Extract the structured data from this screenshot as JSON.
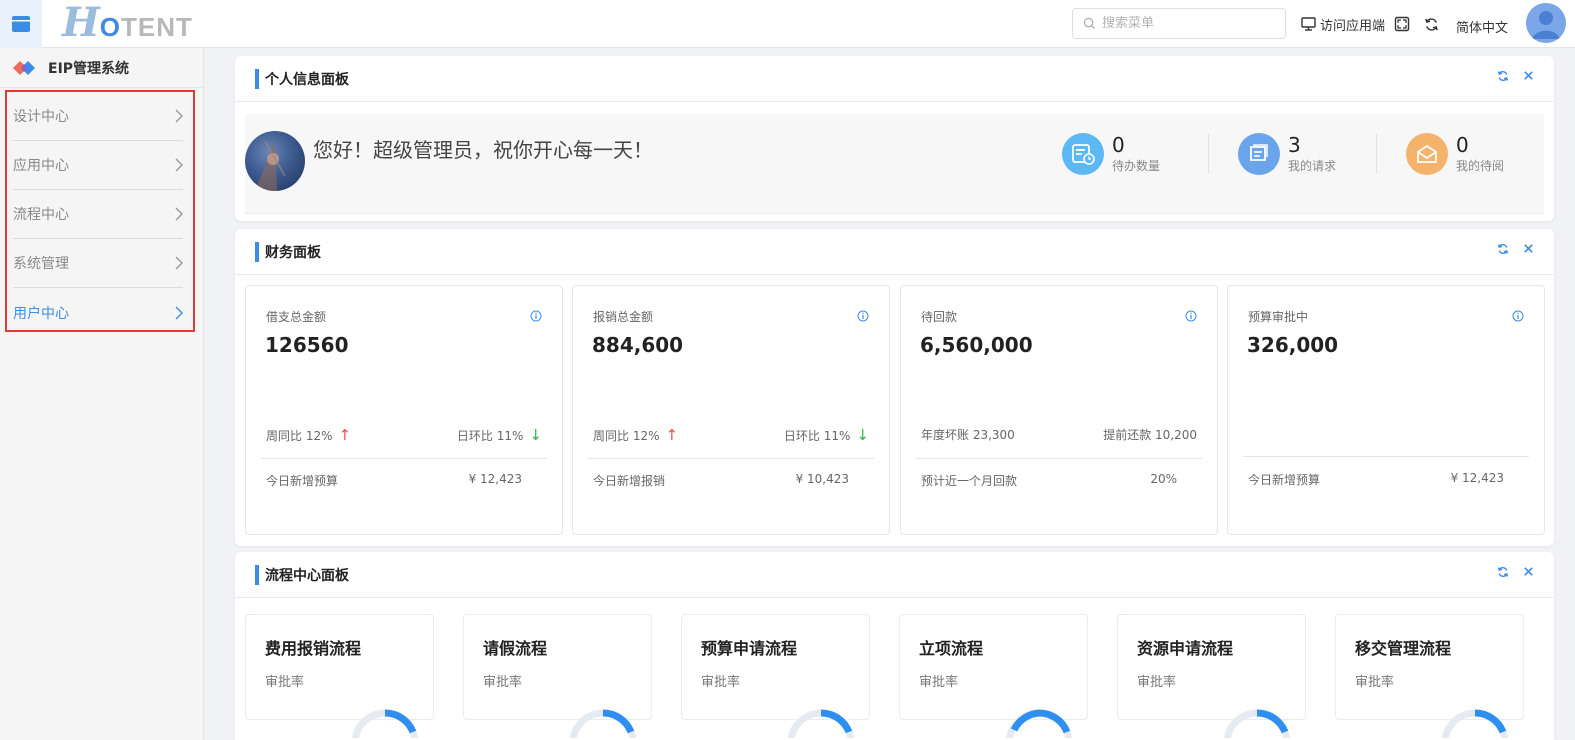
{
  "header": {
    "logo_h": "H",
    "logo_o": "O",
    "logo_rest": "TENT",
    "search_placeholder": "搜索菜单",
    "visit_app": "访问应用端",
    "language": "简体中文"
  },
  "sidebar": {
    "title": "EIP管理系统",
    "items": [
      {
        "label": "设计中心",
        "active": false
      },
      {
        "label": "应用中心",
        "active": false
      },
      {
        "label": "流程中心",
        "active": false
      },
      {
        "label": "系统管理",
        "active": false
      },
      {
        "label": "用户中心",
        "active": true
      }
    ]
  },
  "personal_panel": {
    "title": "个人信息面板",
    "greeting": "您好！超级管理员，祝你开心每一天！",
    "stats": [
      {
        "value": "0",
        "label": "待办数量",
        "icon": "todo-list-icon",
        "color": "#5cb8f2"
      },
      {
        "value": "3",
        "label": "我的请求",
        "icon": "request-icon",
        "color": "#6aa5ec"
      },
      {
        "value": "0",
        "label": "我的待阅",
        "icon": "mail-icon",
        "color": "#f5b26b"
      }
    ]
  },
  "finance_panel": {
    "title": "财务面板",
    "cards": [
      {
        "label": "借支总金额",
        "value": "126560",
        "left": "周同比 12%",
        "left_arrow": "↑",
        "right": "日环比 11%",
        "right_arrow": "↓",
        "footer_label": "今日新增预算",
        "footer_value": "¥ 12,423"
      },
      {
        "label": "报销总金额",
        "value": "884,600",
        "left": "周同比 12%",
        "left_arrow": "↑",
        "right": "日环比 11%",
        "right_arrow": "↓",
        "footer_label": "今日新增报销",
        "footer_value": "¥ 10,423"
      },
      {
        "label": "待回款",
        "value": "6,560,000",
        "left": "年度坏账 23,300",
        "left_arrow": "",
        "right": "提前还款 10,200",
        "right_arrow": "",
        "footer_label": "预计近一个月回款",
        "footer_value": "20%"
      },
      {
        "label": "预算审批中",
        "value": "326,000",
        "left": "",
        "left_arrow": "",
        "right": "",
        "right_arrow": "",
        "footer_label": "今日新增预算",
        "footer_value": "¥ 12,423"
      }
    ]
  },
  "flow_panel": {
    "title": "流程中心面板",
    "cards": [
      {
        "title": "费用报销流程",
        "sub": "审批率"
      },
      {
        "title": "请假流程",
        "sub": "审批率"
      },
      {
        "title": "预算申请流程",
        "sub": "审批率"
      },
      {
        "title": "立项流程",
        "sub": "审批率"
      },
      {
        "title": "资源申请流程",
        "sub": "审批率"
      },
      {
        "title": "移交管理流程",
        "sub": "审批率"
      }
    ]
  },
  "colors": {
    "accent": "#3c8ce7",
    "up": "#f05050",
    "down": "#36b24a",
    "sidebar_highlight": "#e53935"
  }
}
